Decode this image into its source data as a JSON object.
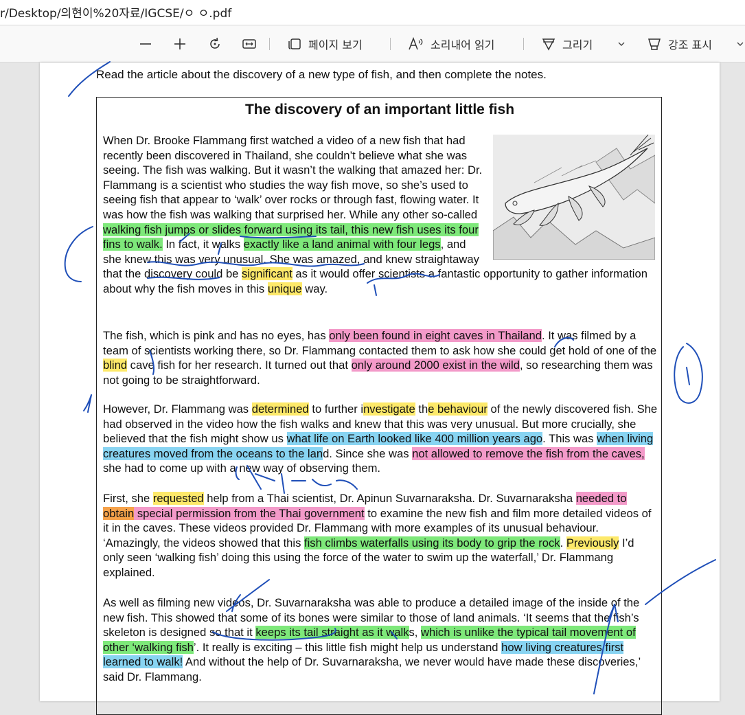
{
  "address_bar": {
    "url": "r/Desktop/의현이%20자료/IGCSE/ㅇ ㅇ.pdf"
  },
  "toolbar": {
    "zoom_out_icon": "minus-icon",
    "zoom_in_icon": "plus-icon",
    "rotate_icon": "rotate-icon",
    "fit_icon": "fit-width-icon",
    "page_view_label": "페이지 보기",
    "read_aloud_label": "소리내어 읽기",
    "draw_label": "그리기",
    "highlight_label": "강조 표시"
  },
  "colors": {
    "green": "#7ee87a",
    "yellow": "#fde96a",
    "pink": "#f39ac9",
    "blue": "#88d4f2",
    "orange": "#f6a24a",
    "ink": "#1f4fb8"
  },
  "document": {
    "instruction": "Read the article about the discovery of a new type of fish, and then complete the notes.",
    "title": "The discovery of an important little fish",
    "figure_icon": "walking-fish-illustration",
    "paragraphs": [
      [
        {
          "t": "When Dr. Brooke Flammang first watched a video of a new fish that had recently been discovered in Thailand, she couldn’t believe what she was seeing. The fish was walking. But it wasn’t the walking that amazed her: Dr. Flammang is a scientist who studies the way fish move, so she’s used to seeing fish that appear to ‘walk’ over rocks or through fast, flowing water. It was how the fish was walking that surprised her. While any other so-called ",
          "h": "plain"
        },
        {
          "t": "walking fish jumps or slides forward using its tail, this new fish uses its four fins to walk.",
          "h": "green"
        },
        {
          "t": " In fact, it walks ",
          "h": "plain"
        },
        {
          "t": "exactly like a land animal with four legs",
          "h": "green"
        },
        {
          "t": ", and she knew this was very unusual. She was amazed, and knew straightaway that the discovery could be ",
          "h": "plain"
        },
        {
          "t": "significant",
          "h": "yellow"
        },
        {
          "t": " as it would offer scientists a fantastic opportunity to gather information about why the fish moves in this ",
          "h": "plain"
        },
        {
          "t": "unique",
          "h": "yellow"
        },
        {
          "t": " way.",
          "h": "plain"
        }
      ],
      [
        {
          "t": "The fish, which is pink and has no eyes, has ",
          "h": "plain"
        },
        {
          "t": "only been found in eight caves in Thailand",
          "h": "pink"
        },
        {
          "t": ". It was filmed by a team of scientists working there, so Dr. Flammang contacted them to ask how she could get hold of one of the ",
          "h": "plain"
        },
        {
          "t": "blind",
          "h": "yellow"
        },
        {
          "t": " cave fish for her research. It turned out that ",
          "h": "plain"
        },
        {
          "t": "only around 2000 exist in the wild",
          "h": "pink"
        },
        {
          "t": ", so researching them was not going to be straightforward.",
          "h": "plain"
        }
      ],
      [
        {
          "t": "However, Dr. Flammang was ",
          "h": "plain"
        },
        {
          "t": "determined",
          "h": "yellow"
        },
        {
          "t": " to further i",
          "h": "plain"
        },
        {
          "t": "nvestigate",
          "h": "yellow"
        },
        {
          "t": " th",
          "h": "plain"
        },
        {
          "t": "e behaviour",
          "h": "yellow"
        },
        {
          "t": " of the newly discovered fish. She had observed in the video how the fish walks and knew that this was very unusual. But more crucially, she believed that the fish might show us ",
          "h": "plain"
        },
        {
          "t": "what life on Earth looked like 400 million years ago",
          "h": "blue"
        },
        {
          "t": ". This was ",
          "h": "plain"
        },
        {
          "t": "when living creatures moved from the oceans to the lan",
          "h": "blue"
        },
        {
          "t": "d. Since she was ",
          "h": "plain"
        },
        {
          "t": "not allowed to remove the fish from the caves,",
          "h": "pink"
        },
        {
          "t": " she had to come up with a new way of observing them.",
          "h": "plain"
        }
      ],
      [
        {
          "t": "First, she ",
          "h": "plain"
        },
        {
          "t": "requested",
          "h": "yellow"
        },
        {
          "t": " help from a Thai scientist, Dr. Apinun Suvarnaraksha. Dr. Suvarnaraksha ",
          "h": "plain"
        },
        {
          "t": "needed to ",
          "h": "pink"
        },
        {
          "t": "obtain",
          "h": "orange"
        },
        {
          "t": " special permission from the Thai government",
          "h": "pink"
        },
        {
          "t": " to examine the new fish and film more detailed videos of it in the caves. These videos provided Dr. Flammang with more examples of its unusual behaviour. ‘Amazingly, the videos showed that this ",
          "h": "plain"
        },
        {
          "t": "fish climbs waterfalls using its body to grip the rock",
          "h": "green"
        },
        {
          "t": ". ",
          "h": "plain"
        },
        {
          "t": "Previously",
          "h": "yellow"
        },
        {
          "t": " I’d only seen ‘walking fish’ doing this using the force of the water to swim up the waterfall,’ Dr. Flammang explained.",
          "h": "plain"
        }
      ],
      [
        {
          "t": "As well as filming new videos, Dr. Suvarnaraksha was able to produce a detailed image of the inside of the new fish. This showed that some of its bones were similar to those of land animals. ‘It seems that the fish’s skeleton is designed so that it ",
          "h": "plain"
        },
        {
          "t": "keeps its tail straight as it walk",
          "h": "green"
        },
        {
          "t": "s, ",
          "h": "plain"
        },
        {
          "t": "which is unlike the typical tail movement of other ‘walking fish",
          "h": "green"
        },
        {
          "t": "’. It really is exciting – this little fish might help us understand ",
          "h": "plain"
        },
        {
          "t": "how living creatures first learned to walk!",
          "h": "blue"
        },
        {
          "t": " And without the help of Dr. Suvarnaraksha, we never would have made these discoveries,’ said Dr. Flammang.",
          "h": "plain"
        }
      ]
    ]
  }
}
